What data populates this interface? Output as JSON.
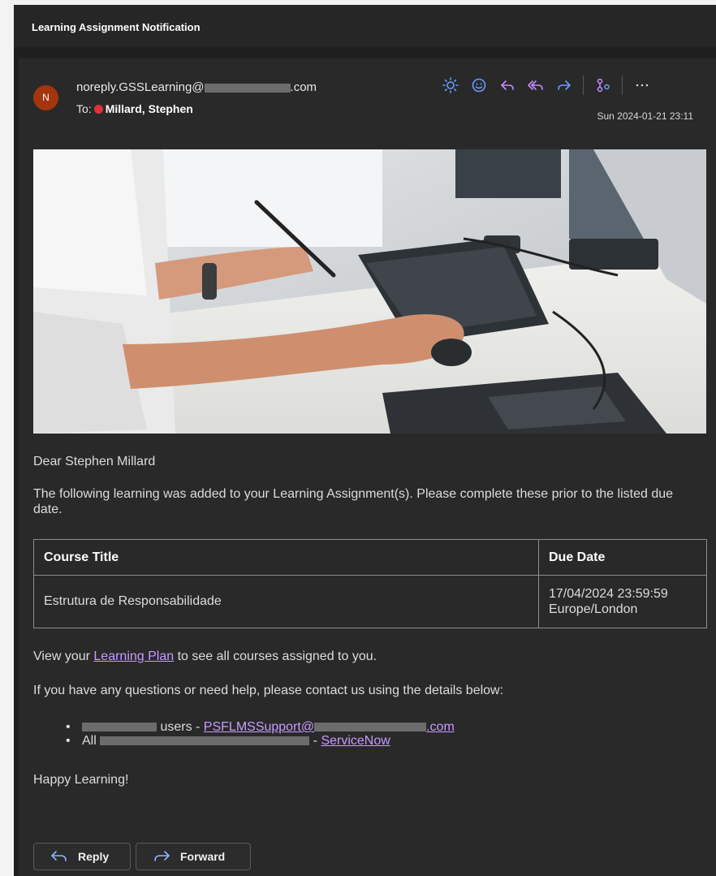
{
  "window": {
    "title": "Learning Assignment Notification"
  },
  "header": {
    "avatar_initial": "N",
    "from_prefix": "noreply.GSSLearning@",
    "from_suffix": ".com",
    "to_label": "To:",
    "to_name": "Millard, Stephen",
    "date": "Sun 2024-01-21 23:11",
    "actions": [
      "brightness-icon",
      "emoji-icon",
      "reply-icon",
      "reply-all-icon",
      "forward-icon",
      "apps-icon",
      "more-icon"
    ]
  },
  "body": {
    "greeting": "Dear Stephen Millard",
    "intro": "The following learning was added to your Learning Assignment(s). Please complete these prior to the listed due date.",
    "table": {
      "headers": [
        "Course Title",
        "Due Date"
      ],
      "rows": [
        {
          "course": "Estrutura de Responsabilidade",
          "due_line1": "17/04/2024 23:59:59",
          "due_line2": "Europe/London"
        }
      ]
    },
    "view_prefix": "View your ",
    "view_link": "Learning Plan",
    "view_suffix": " to see all courses assigned to you.",
    "contact": "If you have any questions or need help, please contact us using the details below:",
    "bullets": [
      {
        "text": "users - ",
        "link": "PSFLMSSupport@",
        "link_end": ".com"
      },
      {
        "prefix": "All ",
        "text": " - ",
        "link": "ServiceNow"
      }
    ],
    "closing": "Happy Learning!"
  },
  "footer": {
    "reply": "Reply",
    "forward": "Forward"
  },
  "colors": {
    "link": "#c79bff",
    "icon": "#6b9bff",
    "avatar": "#a4350c",
    "presence": "#e0303a"
  }
}
